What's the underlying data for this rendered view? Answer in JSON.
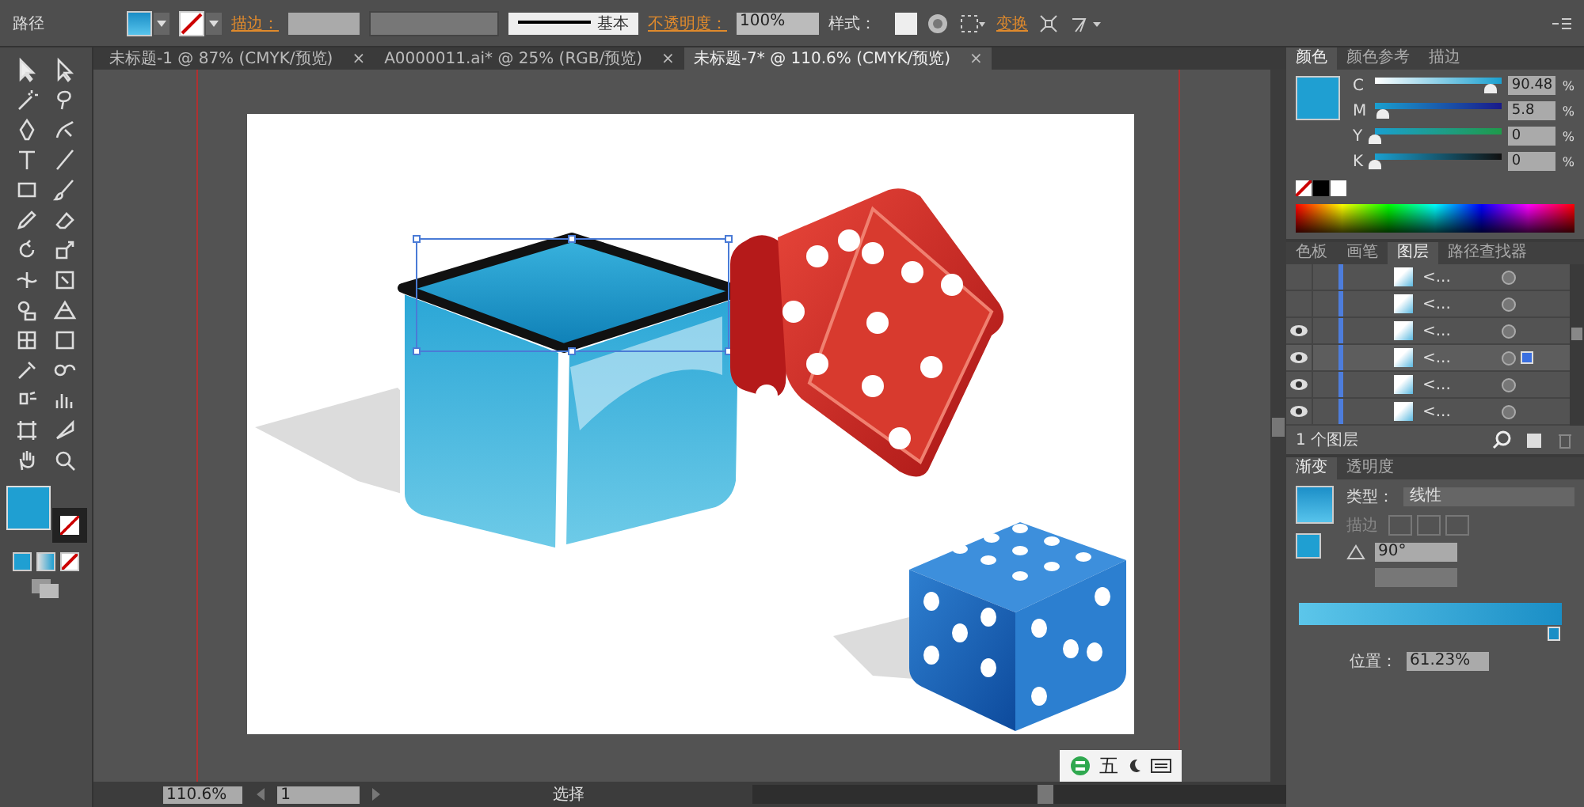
{
  "control_bar": {
    "object_type": "路径",
    "stroke_label": "描边：",
    "stroke_style": "基本",
    "opacity_label": "不透明度：",
    "opacity": "100%",
    "style_label": "样式：",
    "transform_label": "变换"
  },
  "doc_tabs": [
    {
      "title": "未标题-1 @ 87% (CMYK/预览)",
      "close": "×",
      "selected": false
    },
    {
      "title": "A0000011.ai* @ 25% (RGB/预览)",
      "close": "×",
      "selected": false
    },
    {
      "title": "未标题-7* @ 110.6% (CMYK/预览)",
      "close": "×",
      "selected": true
    }
  ],
  "color_panel": {
    "tabs": [
      {
        "label": "颜色",
        "selected": true
      },
      {
        "label": "颜色参考",
        "selected": false
      },
      {
        "label": "描边",
        "selected": false
      }
    ],
    "channels": [
      {
        "name": "C",
        "level": 0.9048,
        "value": "90.48",
        "unit": "%"
      },
      {
        "name": "M",
        "level": 0.058,
        "value": "5.8",
        "unit": "%"
      },
      {
        "name": "Y",
        "level": 0,
        "value": "0",
        "unit": "%"
      },
      {
        "name": "K",
        "level": 0,
        "value": "0",
        "unit": "%"
      }
    ]
  },
  "layers_panel": {
    "tabs": [
      {
        "label": "色板",
        "selected": false
      },
      {
        "label": "画笔",
        "selected": false
      },
      {
        "label": "图层",
        "selected": true
      },
      {
        "label": "路径查找器",
        "selected": false
      }
    ],
    "rows": [
      {
        "name": "<...",
        "visible": false,
        "selected": false
      },
      {
        "name": "<...",
        "visible": false,
        "selected": false
      },
      {
        "name": "<...",
        "visible": true,
        "selected": false
      },
      {
        "name": "<...",
        "visible": true,
        "selected": true
      },
      {
        "name": "<...",
        "visible": true,
        "selected": false
      },
      {
        "name": "<...",
        "visible": true,
        "selected": false
      }
    ],
    "count": "1 个图层"
  },
  "gradient_panel": {
    "tabs": [
      {
        "label": "渐变",
        "selected": true
      },
      {
        "label": "透明度",
        "selected": false
      }
    ],
    "type_label": "类型：",
    "type": "线性",
    "stroke_label": "描边",
    "angle": "90°",
    "gradient_slider": {
      "level": 0.97
    },
    "location_label": "位置：",
    "location": "61.23%"
  },
  "status_bar": {
    "zoom": "110.6%",
    "artboard": "1",
    "tool": "选择"
  },
  "ime_bar": {
    "mode": "五"
  }
}
